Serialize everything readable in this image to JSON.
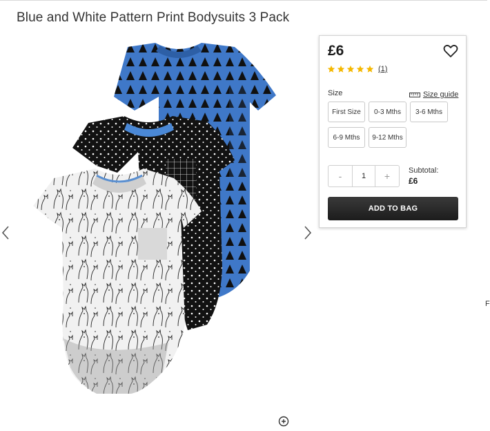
{
  "product": {
    "title": "Blue and White Pattern Print Bodysuits 3 Pack",
    "price": "£6",
    "rating": 5,
    "rating_max": 5,
    "review_count": "(1)"
  },
  "size": {
    "label": "Size",
    "guide_label": "Size guide",
    "options": [
      "First Size",
      "0-3 Mths",
      "3-6 Mths",
      "6-9 Mths",
      "9-12 Mths"
    ]
  },
  "quantity": {
    "minus": "-",
    "value": "1",
    "plus": "+"
  },
  "subtotal": {
    "label": "Subtotal:",
    "value": "£6"
  },
  "cart": {
    "add_label": "ADD TO BAG"
  },
  "edge_text": "F",
  "icons": {
    "prev": "chevron-left-icon",
    "next": "chevron-right-icon",
    "wishlist": "heart-icon",
    "star": "star-icon",
    "ruler": "ruler-icon",
    "zoom": "zoom-in-icon"
  },
  "colors": {
    "star": "#f5b800",
    "blue_bodysuit": "#3f78c8",
    "add_button": "#262626"
  }
}
